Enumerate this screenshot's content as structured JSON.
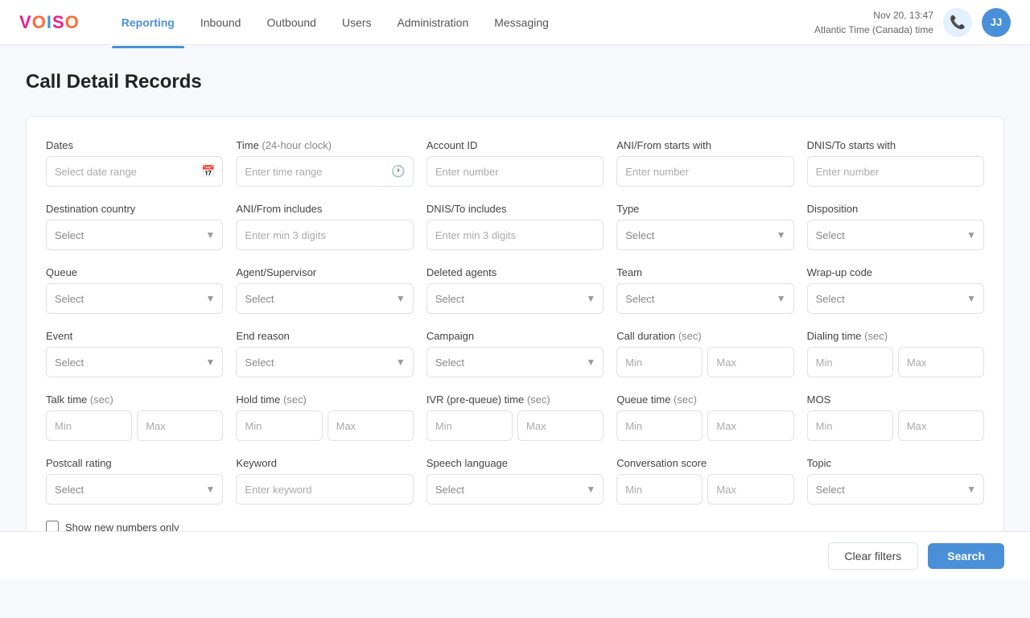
{
  "logo": {
    "v": "V",
    "o": "O",
    "i": "I",
    "s": "S",
    "o2": "O"
  },
  "nav": {
    "links": [
      {
        "label": "Reporting",
        "active": true
      },
      {
        "label": "Inbound",
        "active": false
      },
      {
        "label": "Outbound",
        "active": false
      },
      {
        "label": "Users",
        "active": false
      },
      {
        "label": "Administration",
        "active": false
      },
      {
        "label": "Messaging",
        "active": false
      }
    ],
    "datetime_line1": "Nov 20, 13:47",
    "datetime_line2": "Atlantic Time (Canada) time",
    "avatar_initials": "JJ"
  },
  "page": {
    "title": "Call Detail Records"
  },
  "filters": {
    "dates_label": "Dates",
    "dates_placeholder": "Select date range",
    "time_label": "Time",
    "time_sub": "(24-hour clock)",
    "time_placeholder": "Enter time range",
    "account_id_label": "Account ID",
    "account_id_placeholder": "Enter number",
    "ani_from_starts_label": "ANI/From starts with",
    "ani_from_starts_placeholder": "Enter number",
    "dnis_to_starts_label": "DNIS/To starts with",
    "dnis_to_starts_placeholder": "Enter number",
    "dest_country_label": "Destination country",
    "ani_from_includes_label": "ANI/From includes",
    "ani_from_includes_placeholder": "Enter min 3 digits",
    "dnis_to_includes_label": "DNIS/To includes",
    "dnis_to_includes_placeholder": "Enter min 3 digits",
    "type_label": "Type",
    "disposition_label": "Disposition",
    "queue_label": "Queue",
    "agent_supervisor_label": "Agent/Supervisor",
    "deleted_agents_label": "Deleted agents",
    "team_label": "Team",
    "wrap_up_code_label": "Wrap-up code",
    "event_label": "Event",
    "end_reason_label": "End reason",
    "campaign_label": "Campaign",
    "call_duration_label": "Call duration",
    "call_duration_sub": "(sec)",
    "dialing_time_label": "Dialing time",
    "dialing_time_sub": "(sec)",
    "talk_time_label": "Talk time",
    "talk_time_sub": "(sec)",
    "hold_time_label": "Hold time",
    "hold_time_sub": "(sec)",
    "ivr_time_label": "IVR (pre-queue) time",
    "ivr_time_sub": "(sec)",
    "queue_time_label": "Queue time",
    "queue_time_sub": "(sec)",
    "mos_label": "MOS",
    "postcall_rating_label": "Postcall rating",
    "keyword_label": "Keyword",
    "keyword_placeholder": "Enter keyword",
    "speech_language_label": "Speech language",
    "conversation_score_label": "Conversation score",
    "topic_label": "Topic",
    "show_new_numbers_label": "Show new numbers only",
    "select_placeholder": "Select",
    "min_placeholder": "Min",
    "max_placeholder": "Max",
    "clear_filters_label": "Clear filters",
    "search_label": "Search"
  }
}
